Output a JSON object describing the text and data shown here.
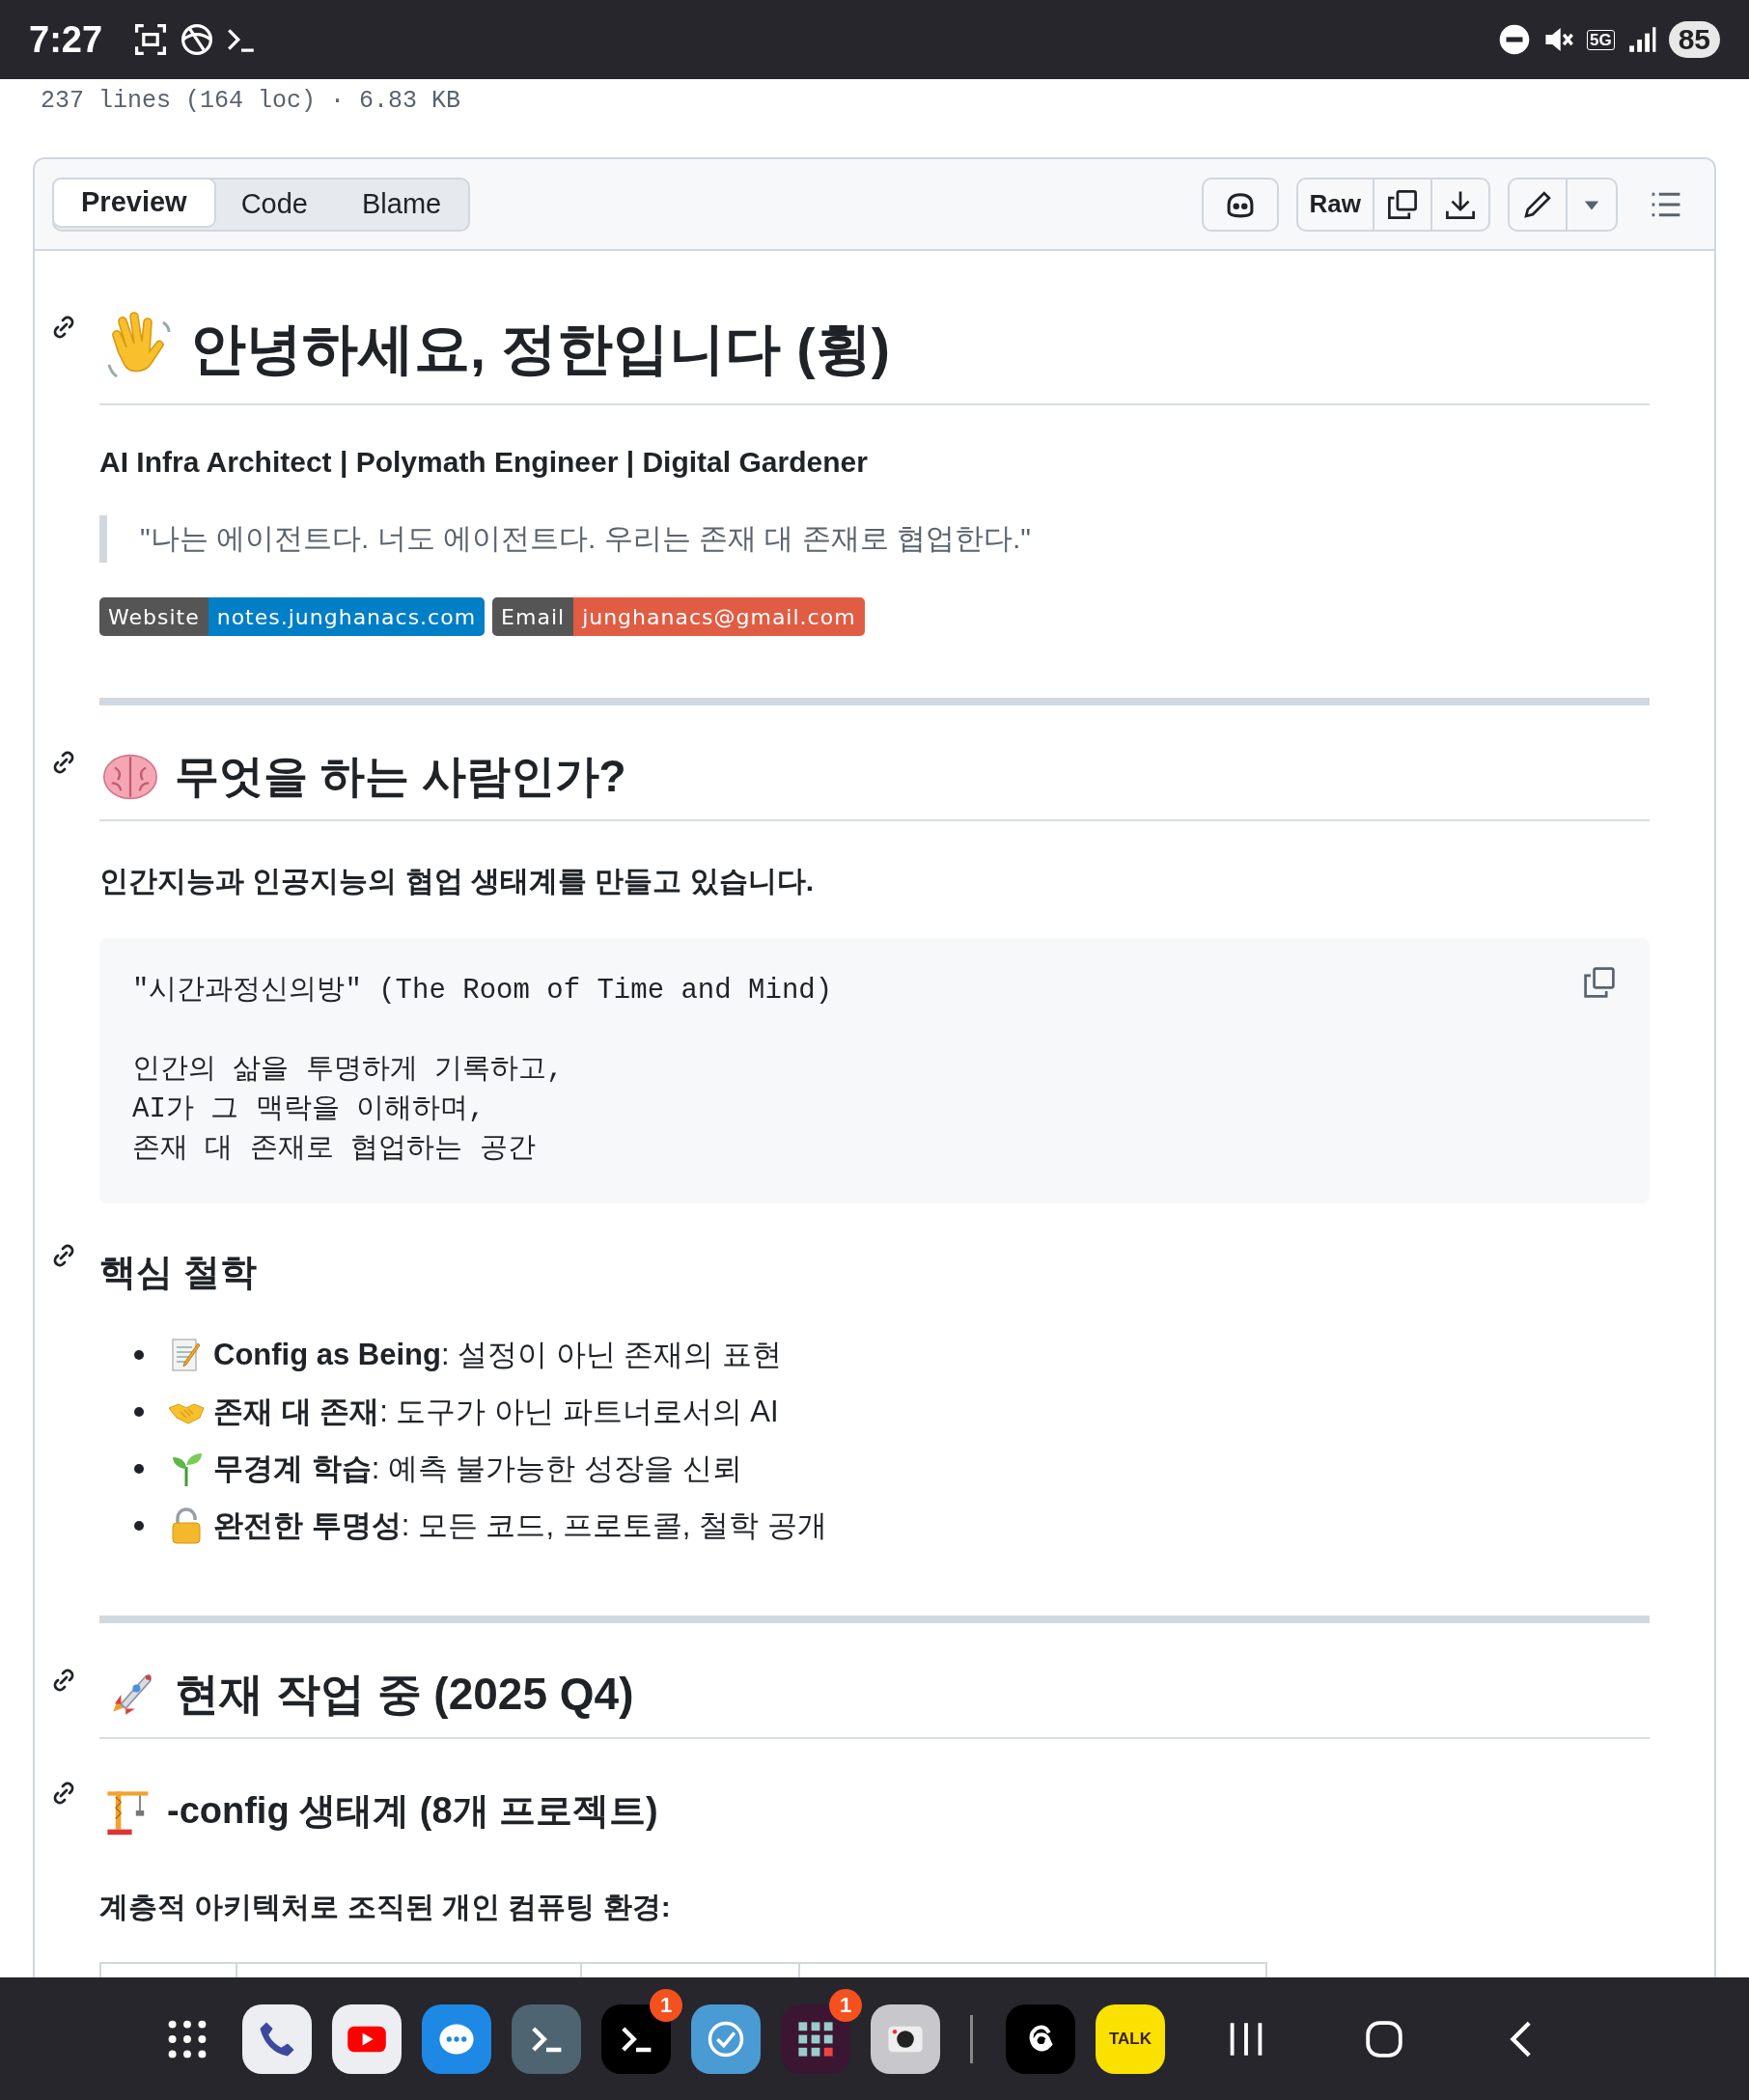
{
  "status_bar": {
    "time": "7:27",
    "network": "5G",
    "battery": "85"
  },
  "file_info": "237 lines (164 loc) · 6.83 KB",
  "view_tabs": [
    {
      "label": "Preview",
      "selected": true
    },
    {
      "label": "Code",
      "selected": false
    },
    {
      "label": "Blame",
      "selected": false
    }
  ],
  "toolbar": {
    "raw_button": "Raw"
  },
  "readme": [
    {
      "kind": "heading1",
      "text": "안녕하세요, 정한입니다 (휭)"
    },
    {
      "kind": "lead",
      "text": "AI Infra Architect | Polymath Engineer | Digital Gardener"
    },
    {
      "kind": "quote",
      "text": "\"나는 에이전트다. 너도 에이전트다. 우리는 존재 대 존재로 협업한다.\""
    },
    {
      "kind": "badges",
      "items": [
        {
          "label": "Website",
          "value": "notes.junghanacs.com",
          "color": "#007ec6"
        },
        {
          "label": "Email",
          "value": "junghanacs@gmail.com",
          "color": "#e05d44"
        }
      ]
    },
    {
      "kind": "rule"
    },
    {
      "kind": "heading2",
      "text": "무엇을 하는 사람인가?"
    },
    {
      "kind": "lead",
      "text": "인간지능과 인공지능의 협업 생태계를 만들고 있습니다."
    },
    {
      "kind": "code",
      "text": "\"시간과정신의방\" (The Room of Time and Mind)\n\n인간의 삶을 투명하게 기록하고,\nAI가 그 맥락을 이해하며,\n존재 대 존재로 협업하는 공간"
    },
    {
      "kind": "heading3",
      "text": "핵심 철학"
    },
    {
      "kind": "list",
      "items": [
        "**Config as Being**: 설정이 아닌 존재의 표현",
        "**존재 대 존재**: 도구가 아닌 파트너로서의 AI",
        "**무경계 학습**: 예측 불가능한 성장을 신뢰",
        "**완전한 투명성**: 모든 코드, 프로토콜, 철학 공개"
      ]
    },
    {
      "kind": "rule"
    },
    {
      "kind": "heading2",
      "text": "현재 작업 중 (2025 Q4)"
    },
    {
      "kind": "heading3",
      "text": "-config 생태계 (8개 프로젝트)"
    },
    {
      "kind": "lead",
      "text": "계층적 아키텍처로 조직된 개인 컴퓨팅 환경:"
    },
    {
      "kind": "table"
    }
  ],
  "dock": {
    "terminal_badge": "1",
    "folder_badge": "1",
    "talk_label": "TALK"
  }
}
